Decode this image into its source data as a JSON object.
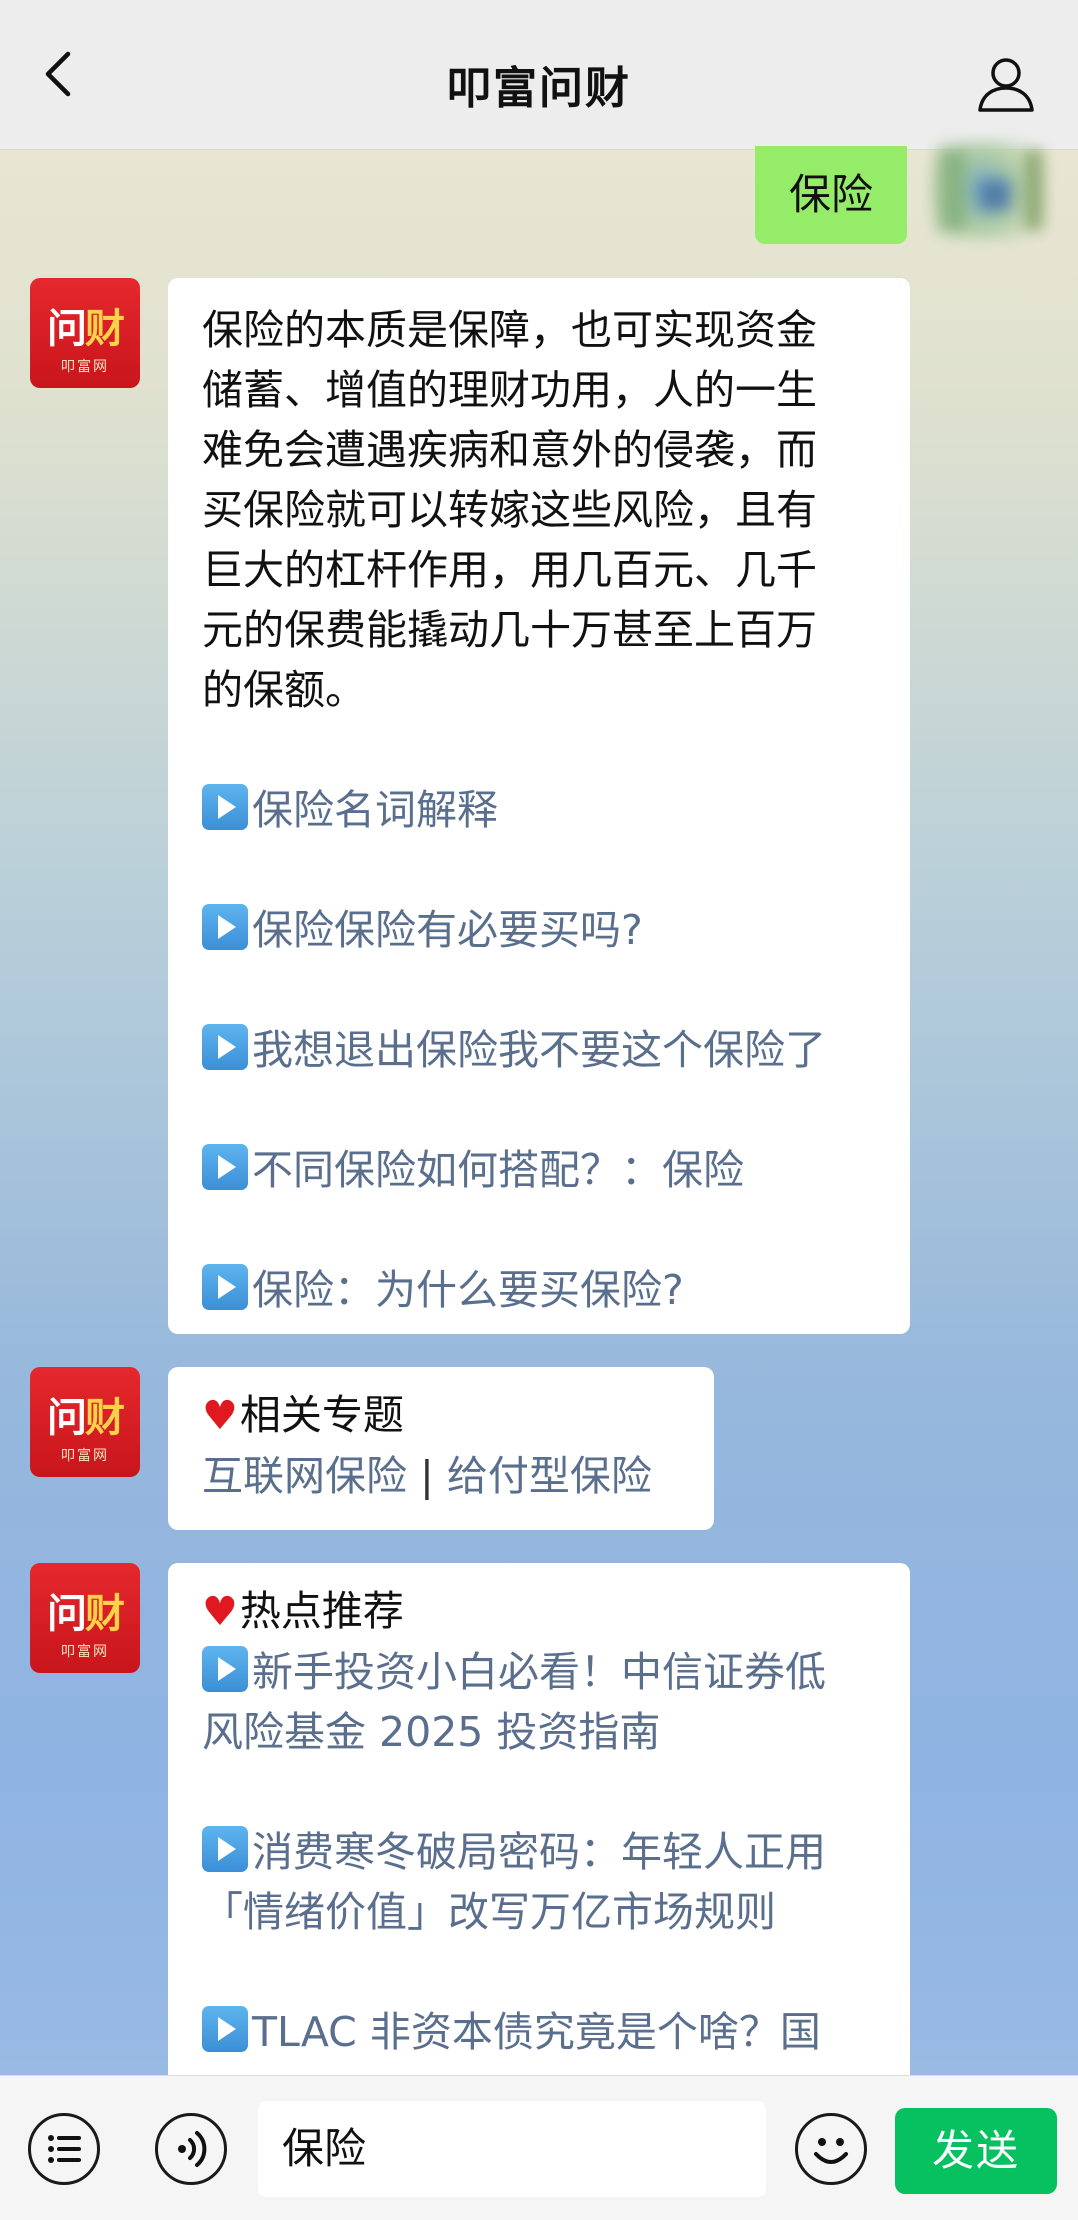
{
  "header": {
    "title": "叩富问财"
  },
  "user_message": "保险",
  "bot_logo": {
    "main_a": "问",
    "main_b": "财",
    "sub": "叩富网"
  },
  "messages": [
    {
      "intro": [
        "保险的本质是保障，也可实现资金",
        "储蓄、增值的理财功用，人的一生",
        "难免会遭遇疾病和意外的侵袭，而",
        "买保险就可以转嫁这些风险，且有",
        "巨大的杠杆作用，用几百元、几千",
        "元的保费能撬动几十万甚至上百万",
        "的保额。"
      ],
      "links": [
        "保险名词解释",
        "保险保险有必要买吗?",
        "我想退出保险我不要这个保险了",
        "不同保险如何搭配？：保险",
        "保险：为什么要买保险?"
      ]
    },
    {
      "heading": "相关专题",
      "topics": [
        "互联网保险",
        "给付型保险"
      ],
      "separator": "|"
    },
    {
      "heading": "热点推荐",
      "items": [
        [
          "新手投资小白必看！中信证券低",
          "风险基金 2025 投资指南"
        ],
        [
          "消费寒冬破局密码：年轻人正用",
          "「情绪价值」改写万亿市场规则"
        ],
        [
          "TLAC 非资本债究竟是个啥？国"
        ]
      ]
    }
  ],
  "input": {
    "value": "保险"
  },
  "send_label": "发送"
}
